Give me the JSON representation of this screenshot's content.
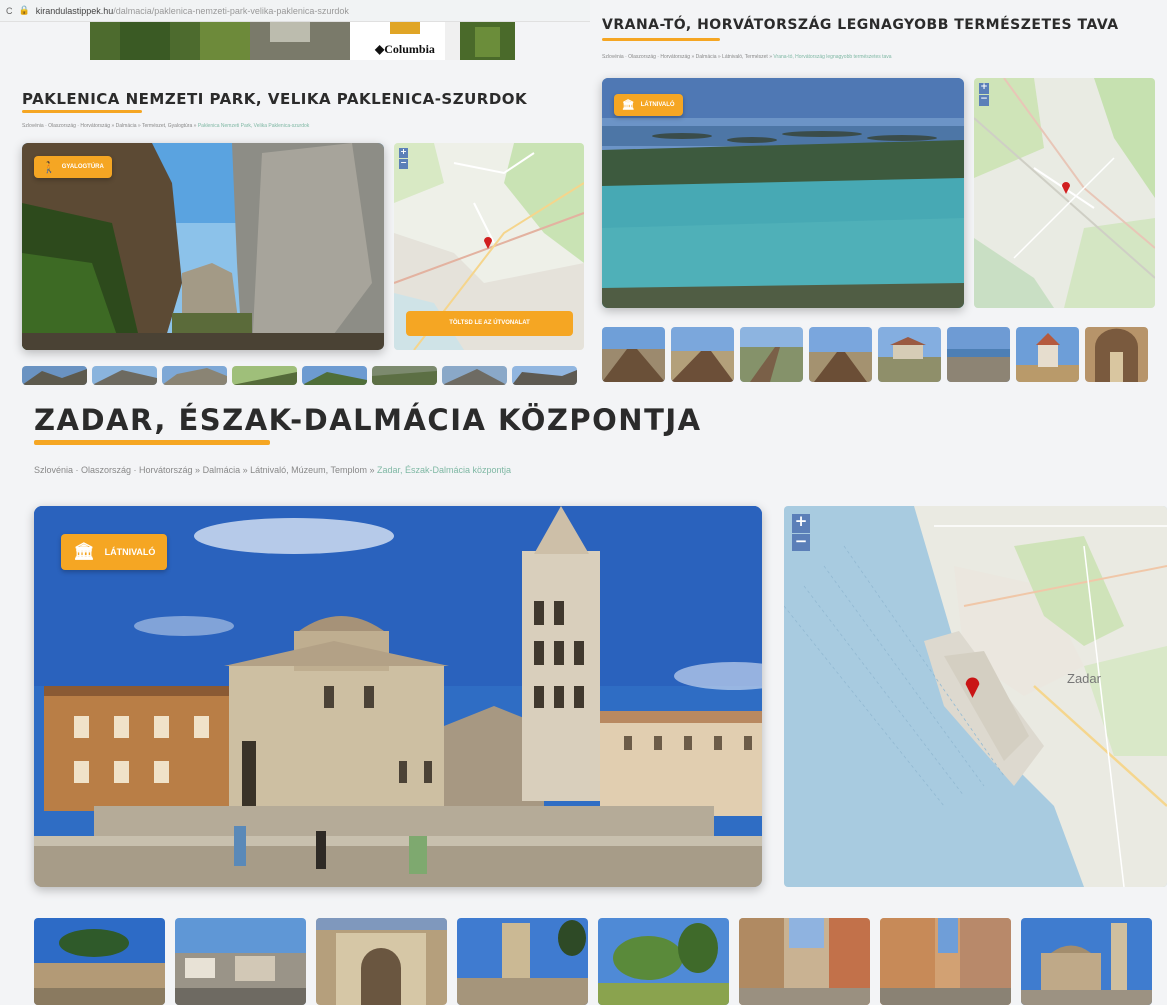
{
  "panel_a": {
    "browser": {
      "reload_icon": "C",
      "lock_icon": "lock",
      "url_host": "kirandulastippek.hu",
      "url_path": "/dalmacia/paklenica-nemzeti-park-velika-paklenica-szurdok"
    },
    "ad_brand": "◆Columbia",
    "title": "PAKLENICA NEMZETI PARK, VELIKA PAKLENICA-SZURDOK",
    "breadcrumb": "Szlovénia · Olaszország · Horvátország » Dalmácia » Természet, Gyalogtúra » ",
    "breadcrumb_current": "Paklenica Nemzeti Park, Velika Paklenica-szurdok",
    "badge": "GYALOGTÚRA",
    "badge_icon": "hiker-icon",
    "cta": "TÖLTSD LE AZ ÚTVONALAT",
    "zoom_in": "+",
    "zoom_out": "−"
  },
  "panel_b": {
    "title": "VRANA-TÓ, HORVÁTORSZÁG LEGNAGYOBB TERMÉSZETES TAVA",
    "breadcrumb": "Szlovénia · Olaszország · Horvátország » Dalmácia » Látnivaló, Természet » ",
    "breadcrumb_current": "Vrana-tó, Horvátország legnagyobb természetes tava",
    "badge": "LÁTNIVALÓ",
    "badge_icon": "landmark-icon",
    "zoom_in": "+",
    "zoom_out": "−"
  },
  "panel_c": {
    "title": "ZADAR, ÉSZAK-DALMÁCIA KÖZPONTJA",
    "breadcrumb": "Szlovénia · Olaszország · Horvátország » Dalmácia » Látnivaló, Múzeum, Templom » ",
    "breadcrumb_current": "Zadar, Észak-Dalmácia központja",
    "badge": "LÁTNIVALÓ",
    "badge_icon": "landmark-icon",
    "map_city": "Zadar",
    "zoom_in": "+",
    "zoom_out": "−"
  },
  "colors": {
    "accent": "#f5a623",
    "title": "#2b2b2b",
    "crumb_current": "#7fb8a4"
  }
}
